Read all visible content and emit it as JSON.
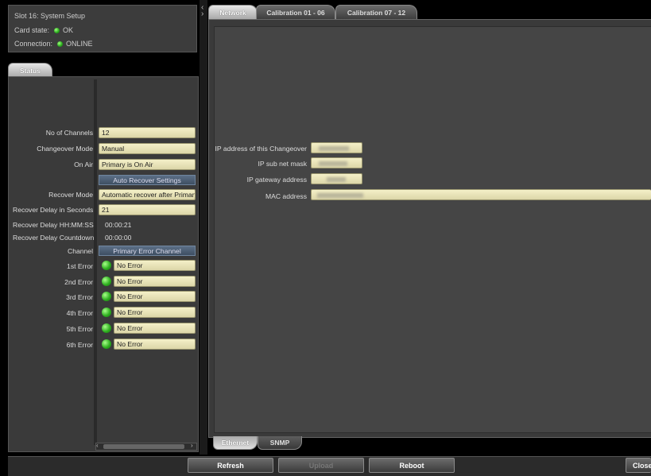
{
  "info": {
    "title": "Slot 16: System Setup",
    "card_state_label": "Card state:",
    "card_state_value": "OK",
    "connection_label": "Connection:",
    "connection_value": "ONLINE"
  },
  "left_tab": "Status",
  "status": {
    "no_of_channels_label": "No of Channels",
    "no_of_channels_value": "12",
    "changeover_mode_label": "Changeover Mode",
    "changeover_mode_value": "Manual",
    "on_air_label": "On Air",
    "on_air_value": "Primary is On Air",
    "auto_recover_header": "Auto Recover Settings",
    "recover_mode_label": "Recover Mode",
    "recover_mode_value": "Automatic recover after Primary f",
    "recover_delay_seconds_label": "Recover Delay in Seconds",
    "recover_delay_seconds_value": "21",
    "recover_delay_hms_label": "Recover Delay HH:MM:SS",
    "recover_delay_hms_value": "00:00:21",
    "recover_delay_countdown_label": "Recover Delay Countdown",
    "recover_delay_countdown_value": "00:00:00",
    "channel_label": "Channel",
    "channel_header": "Primary Error Channel",
    "errors": [
      {
        "label": "1st Error",
        "value": "No Error"
      },
      {
        "label": "2nd Error",
        "value": "No Error"
      },
      {
        "label": "3rd Error",
        "value": "No Error"
      },
      {
        "label": "4th Error",
        "value": "No Error"
      },
      {
        "label": "5th Error",
        "value": "No Error"
      },
      {
        "label": "6th Error",
        "value": "No Error"
      }
    ]
  },
  "top_tabs": [
    "Network",
    "Calibration 01 - 06",
    "Calibration 07 - 12"
  ],
  "network": {
    "ip_label": "IP address of this Changeover",
    "subnet_label": "IP sub net mask",
    "gateway_label": "IP gateway address",
    "mac_label": "MAC address"
  },
  "bottom_tabs": [
    "Ethernet",
    "SNMP"
  ],
  "buttons": {
    "refresh": "Refresh",
    "upload": "Upload",
    "reboot": "Reboot",
    "close": "Close"
  },
  "colors": {
    "led_green": "#2fb020",
    "field_bg": "#f4f0c8",
    "header_blue": "#4a5b72"
  }
}
